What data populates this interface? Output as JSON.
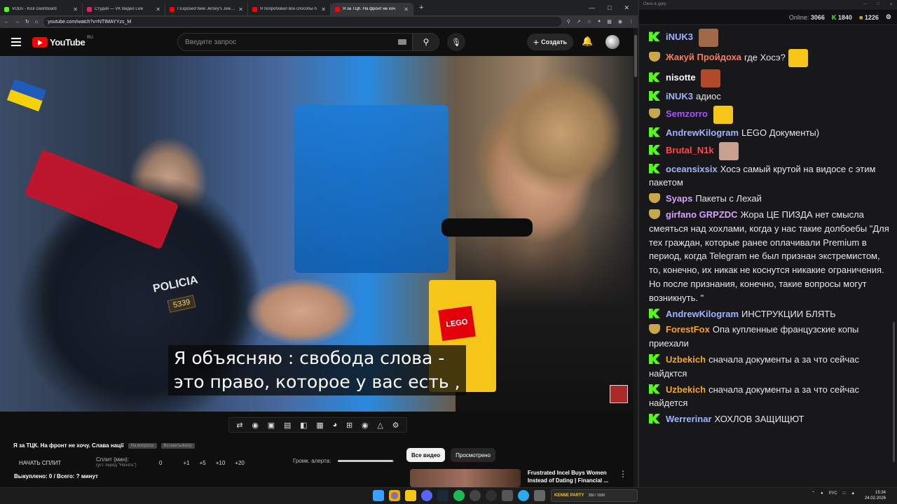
{
  "browser": {
    "tabs": [
      {
        "label": "VODs - Kick Dashboard",
        "color": "#53fc18",
        "active": false
      },
      {
        "label": "Студия — VK Видео Live",
        "color": "#e0245e",
        "active": false
      },
      {
        "label": "I Exposed New Jersey's Jewish",
        "color": "#ff0000",
        "active": false
      },
      {
        "label": "Я попробовал все способы б",
        "color": "#ff0000",
        "active": false
      },
      {
        "label": "Я за ТЦК. На фронт не хоч",
        "color": "#ff0000",
        "active": true
      }
    ],
    "new_tab": "+",
    "url": "youtube.com/watch?v=NTIMAYYzs_M"
  },
  "youtube": {
    "logo_text": "YouTube",
    "region": "RU",
    "search_placeholder": "Введите запрос",
    "create_label": "Создать",
    "subtitle_lines": [
      "Я объясняю : свобода слова -",
      "это право, которое у вас есть ,"
    ],
    "video_title": "Я за ТЦК. На фронт не хочу. Слава нації",
    "title_chips": [
      "На вопросы",
      "Вставить/вопр"
    ],
    "split": {
      "start_label": "НАЧАТЬ СПЛИТ",
      "split_label": "Сплит (мин):",
      "split_hint": "(уст. перед \"Начать\")",
      "value": "0",
      "steps": [
        "+1",
        "+5",
        "+10",
        "+20"
      ]
    },
    "alert_volume_label": "Громк. алерта:",
    "alert_volume_level": 0.98,
    "bought_text": "Выкуплено: 0 / Всего: ? минут",
    "filters": [
      {
        "label": "Все видео",
        "active": true
      },
      {
        "label": "Просмотрено",
        "active": false
      }
    ],
    "recommendation": {
      "title": "Frustrated Incel Buys Women Instead of Dating | Financial ..."
    }
  },
  "chat": {
    "window_title": "Окно в дуку",
    "online_label": "Online:",
    "online_count": "3066",
    "kick_count": "1840",
    "other_count": "1226",
    "messages": [
      {
        "user": "iNUK3",
        "color": "#a0b4ff",
        "badge": "kick",
        "text": "",
        "emote": "#a06a4a"
      },
      {
        "user": "Жакуй Пройдоха",
        "color": "#ff7a5a",
        "badge": "emo",
        "text": "где Хосэ?",
        "emote": "#f5c518"
      },
      {
        "user": "nisotte",
        "color": "#ffffff",
        "badge": "kick",
        "text": "",
        "emote": "#b04a2a"
      },
      {
        "user": "iNUK3",
        "color": "#a0b4ff",
        "badge": "kick",
        "text": "адиос",
        "emote": ""
      },
      {
        "user": "Semzorro",
        "color": "#a855f7",
        "badge": "emo",
        "text": "",
        "emote": "#f5c518"
      },
      {
        "user": "AndrewKilogram",
        "color": "#a0b4ff",
        "badge": "kick",
        "text": "LEGO Документы)",
        "emote": ""
      },
      {
        "user": "Brutal_N1k",
        "color": "#ff4a4a",
        "badge": "kick",
        "text": "",
        "emote": "#c8a090"
      },
      {
        "user": "oceansixsix",
        "color": "#a0b4ff",
        "badge": "kick",
        "text": "Хосэ самый крутой на видосе с этим пакетом",
        "emote": ""
      },
      {
        "user": "Syaps",
        "color": "#d8a0ff",
        "badge": "emo",
        "text": "Пакеты с Лехай",
        "emote": ""
      },
      {
        "user": "girfano GRPZDC",
        "color": "#d8a0ff",
        "badge": "emo",
        "text": "Жора ЦЕ ПИЗДА нет смысла смеяться над хохлами, когда у нас такие долбоебы \"Для тех граждан, которые ранее оплачивали Premium в период, когда Telegram не был признан экстремистом, то, конечно, их никак не коснутся никакие ограничения. Но после признания, конечно, такие вопросы могут возникнуть. \"",
        "emote": ""
      },
      {
        "user": "AndrewKilogram",
        "color": "#a0b4ff",
        "badge": "kick",
        "text": "ИНСТРУКЦИИ БЛЯТЬ",
        "emote": ""
      },
      {
        "user": "ForestFox",
        "color": "#f5a623",
        "badge": "emo",
        "text": "Опа купленные французские копы приехали",
        "emote": ""
      },
      {
        "user": "Uzbekich",
        "color": "#f5a623",
        "badge": "kick",
        "text": "сначала документы а за что сейчас найдктся",
        "emote": ""
      },
      {
        "user": "Uzbekich",
        "color": "#f5a623",
        "badge": "kick",
        "text": "сначала документы а за что сейчас найдется",
        "emote": ""
      },
      {
        "user": "Werrerinar",
        "color": "#a0b4ff",
        "badge": "kick",
        "text": "ХОХЛОВ ЗАЩИЩЮТ",
        "emote": ""
      }
    ]
  },
  "taskbar": {
    "widget_label": "KENNE PARTY",
    "widget_value": "350 / 1500",
    "lang": "РУС",
    "time": "15:34",
    "date": "24.02.2026"
  }
}
